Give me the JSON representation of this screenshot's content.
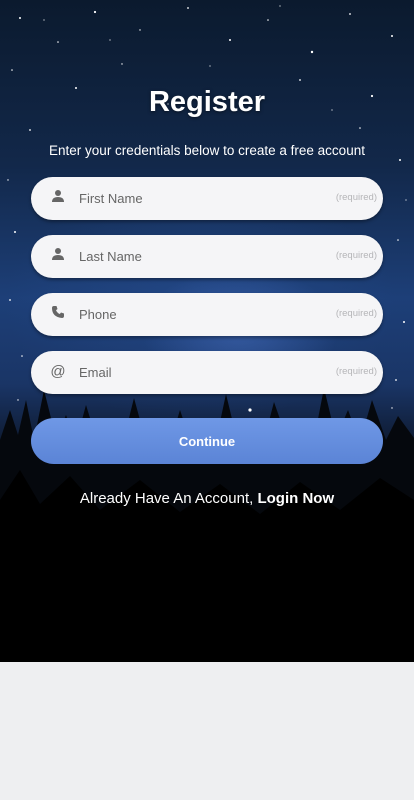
{
  "title": "Register",
  "subtitle": "Enter your credentials below to create a free account",
  "fields": [
    {
      "placeholder": "First Name",
      "required_label": "(required)",
      "icon": "person-icon"
    },
    {
      "placeholder": "Last Name",
      "required_label": "(required)",
      "icon": "person-icon"
    },
    {
      "placeholder": "Phone",
      "required_label": "(required)",
      "icon": "phone-icon"
    },
    {
      "placeholder": "Email",
      "required_label": "(required)",
      "icon": "at-icon"
    }
  ],
  "continue_label": "Continue",
  "login_prompt": "Already Have An Account,",
  "login_link": "Login Now",
  "colors": {
    "accent": "#5b84d6",
    "field_bg": "#f5f5f7",
    "page_bg": "#eeeff1"
  }
}
